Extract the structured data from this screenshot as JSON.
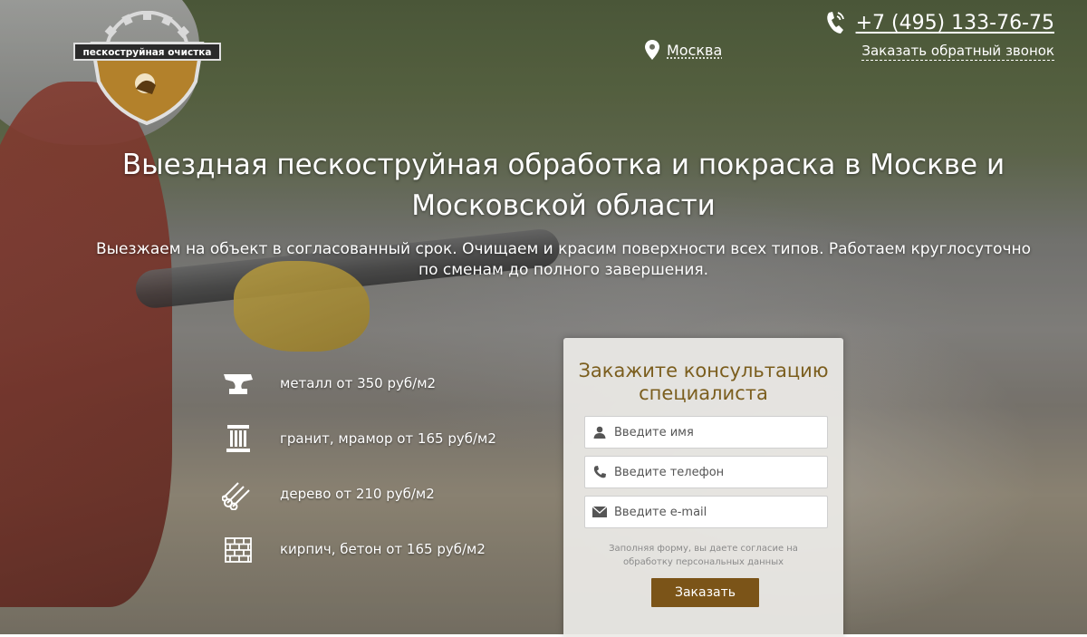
{
  "logo": {
    "text": "пескоструйная очистка"
  },
  "header": {
    "city": "Москва",
    "phone": "+7 (495) 133-76-75",
    "callback": "Заказать обратный звонок"
  },
  "hero": {
    "title_line1": "Выездная пескоструйная обработка и покраска в Москве и",
    "title_line2": "Московской области",
    "subtitle_line1": "Выезжаем на объект в согласованный срок. Очищаем и красим поверхности всех типов. Работаем круглосуточно",
    "subtitle_line2": "по сменам до полного завершения."
  },
  "prices": [
    {
      "icon": "anvil-icon",
      "label": "металл от 350 руб/м2"
    },
    {
      "icon": "column-icon",
      "label": "гранит, мрамор от 165 руб/м2"
    },
    {
      "icon": "logs-icon",
      "label": "дерево от 210 руб/м2"
    },
    {
      "icon": "bricks-icon",
      "label": "кирпич, бетон от 165 руб/м2"
    }
  ],
  "form": {
    "title_line1": "Закажите консультацию",
    "title_line2": "специалиста",
    "name_placeholder": "Введите имя",
    "phone_placeholder": "Введите телефон",
    "email_placeholder": "Введите e-mail",
    "consent_line1": "Заполняя форму, вы даете согласие на",
    "consent_line2": "обработку персональных данных",
    "submit_label": "Заказать"
  },
  "colors": {
    "accent": "#7b5418",
    "title_gold": "#7b5e1e"
  }
}
